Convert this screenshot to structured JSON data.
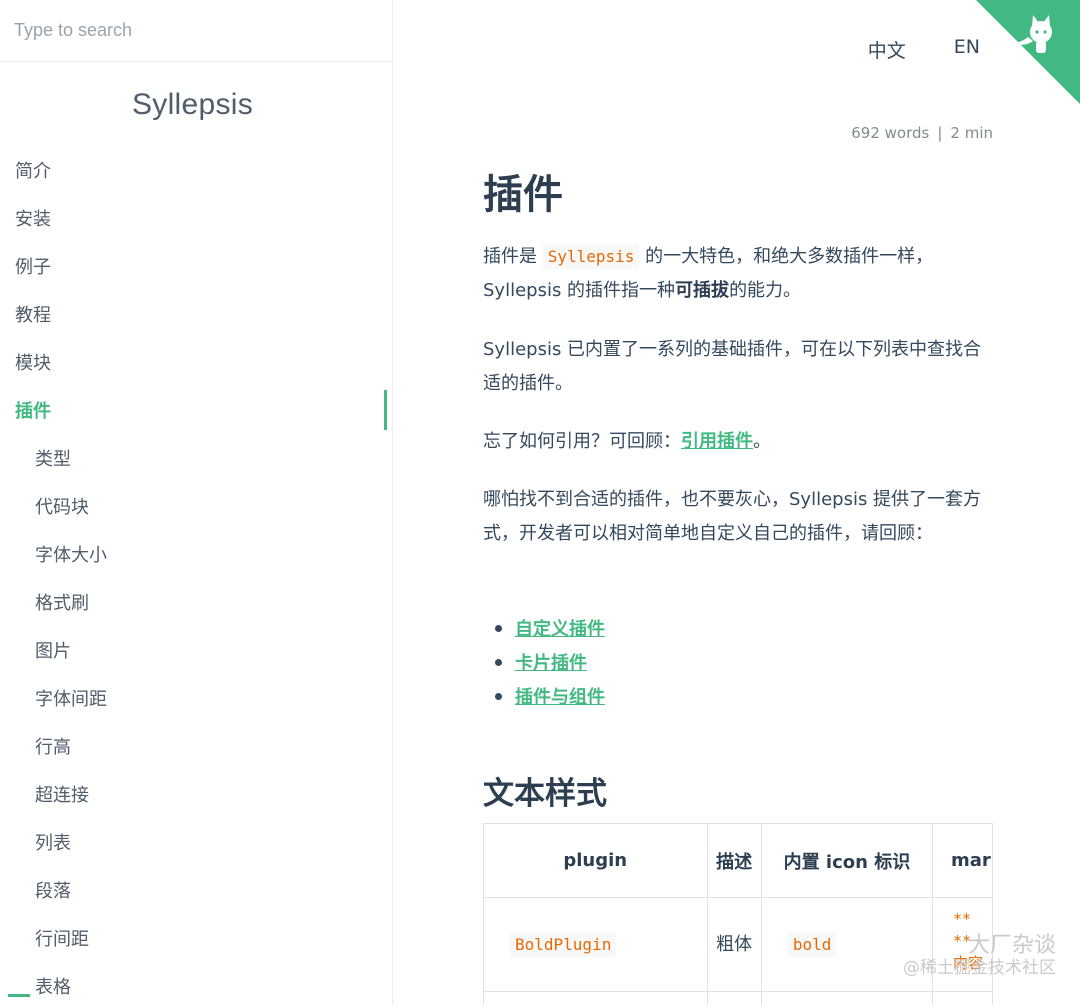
{
  "search": {
    "placeholder": "Type to search"
  },
  "app_name": "Syllepsis",
  "nav": {
    "items": [
      {
        "label": "简介"
      },
      {
        "label": "安装"
      },
      {
        "label": "例子"
      },
      {
        "label": "教程"
      },
      {
        "label": "模块"
      },
      {
        "label": "插件"
      },
      {
        "label": "类型"
      },
      {
        "label": "代码块"
      },
      {
        "label": "字体大小"
      },
      {
        "label": "格式刷"
      },
      {
        "label": "图片"
      },
      {
        "label": "字体间距"
      },
      {
        "label": "行高"
      },
      {
        "label": "超连接"
      },
      {
        "label": "列表"
      },
      {
        "label": "段落"
      },
      {
        "label": "行间距"
      },
      {
        "label": "表格"
      }
    ]
  },
  "lang_nav": {
    "zh": "中文",
    "en": "EN"
  },
  "meta": {
    "words": "692 words",
    "divider": "|",
    "time": "2 min"
  },
  "page": {
    "title": "插件",
    "p1": {
      "pre": "插件是 ",
      "code": "Syllepsis",
      "mid": " 的一大特色，和绝大多数插件一样，Syllepsis 的插件指一种",
      "strong": "可插拔",
      "post": "的能力。"
    },
    "p2": "Syllepsis 已内置了一系列的基础插件，可在以下列表中查找合适的插件。",
    "p3": {
      "pre": "忘了如何引用？可回顾：",
      "link": "引用插件",
      "post": "。"
    },
    "p4": "哪怕找不到合适的插件，也不要灰心，Syllepsis 提供了一套方式，开发者可以相对简单地自定义自己的插件，请回顾：",
    "links": [
      "自定义插件",
      "卡片插件",
      "插件与组件"
    ],
    "section_title": "文本样式",
    "table": {
      "headers": [
        "plugin",
        "描述",
        "内置 icon 标识",
        "mar"
      ],
      "rows": [
        {
          "plugin": "BoldPlugin",
          "desc": "粗体",
          "icon": "bold",
          "markdown": "**\n**\n内容"
        }
      ]
    }
  },
  "watermark": {
    "line1": "大厂杂谈",
    "line2": "@稀土掘金技术社区"
  },
  "colors": {
    "accent": "#42b983",
    "code": "#e96900",
    "text": "#34495e"
  },
  "icons": {
    "corner": "github-octocat-icon"
  }
}
